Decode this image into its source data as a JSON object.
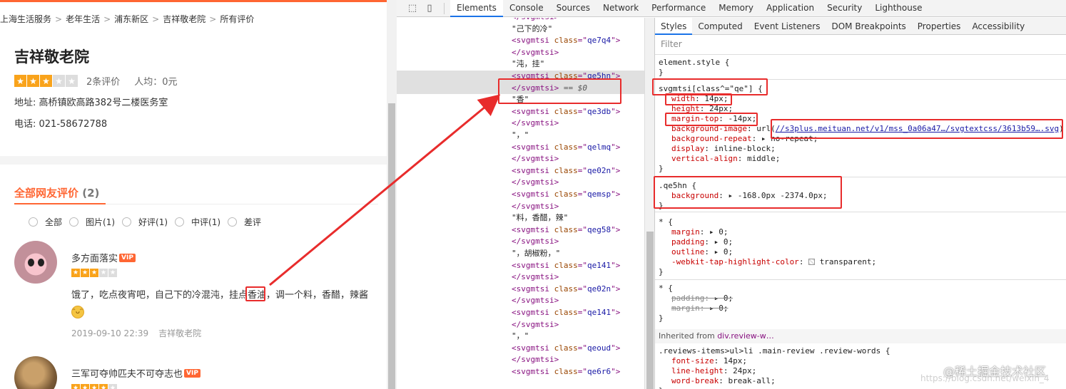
{
  "page": {
    "breadcrumb": [
      "上海生活服务",
      "老年生活",
      "浦东新区",
      "吉祥敬老院",
      "所有评价"
    ],
    "breadcrumb_sep": ">",
    "shop_name": "吉祥敬老院",
    "star_rating": 3,
    "star_max": 5,
    "review_count": "2条评价",
    "avg_price": "人均：0元",
    "address": "地址: 高桥镇欧高路382号二楼医务室",
    "phone": "电话: 021-58672788",
    "reviews_heading": "全部网友评价",
    "reviews_heading_count": "(2)",
    "filters": [
      "全部",
      "图片(1)",
      "好评(1)",
      "中评(1)",
      "差评"
    ],
    "vip_label": "VIP",
    "reviews": [
      {
        "user": "多方面落实",
        "stars": 3,
        "text": "饿了，吃点夜宵吧，自己下的冷混沌，挂点香油，调一个料，香醋，辣酱",
        "date": "2019-09-10 22:39",
        "shop": "吉祥敬老院"
      },
      {
        "user": "三军可夺帅匹夫不可夺志也",
        "stars": 4
      }
    ]
  },
  "devtools": {
    "panels": [
      "Elements",
      "Console",
      "Sources",
      "Network",
      "Performance",
      "Memory",
      "Application",
      "Security",
      "Lighthouse"
    ],
    "active_panel": "Elements",
    "elements_lines": [
      {
        "type": "close",
        "tag": "svgmtsi"
      },
      {
        "type": "text",
        "text": "\"己下的冷\""
      },
      {
        "type": "open",
        "tag": "svgmtsi",
        "attr": "class",
        "val": "qe7q4"
      },
      {
        "type": "close",
        "tag": "svgmtsi"
      },
      {
        "type": "text",
        "text": "\"沌，挂\""
      },
      {
        "type": "open",
        "tag": "svgmtsi",
        "attr": "class",
        "val": "qe5hn",
        "selected": true
      },
      {
        "type": "close",
        "tag": "svgmtsi",
        "selected": true,
        "suffix": " == $0"
      },
      {
        "type": "text",
        "text": "\"香\""
      },
      {
        "type": "open",
        "tag": "svgmtsi",
        "attr": "class",
        "val": "qe3db"
      },
      {
        "type": "close",
        "tag": "svgmtsi"
      },
      {
        "type": "text",
        "text": "\"，\""
      },
      {
        "type": "open",
        "tag": "svgmtsi",
        "attr": "class",
        "val": "qelmq"
      },
      {
        "type": "close",
        "tag": "svgmtsi"
      },
      {
        "type": "open",
        "tag": "svgmtsi",
        "attr": "class",
        "val": "qe02n"
      },
      {
        "type": "close",
        "tag": "svgmtsi"
      },
      {
        "type": "open",
        "tag": "svgmtsi",
        "attr": "class",
        "val": "qemsp"
      },
      {
        "type": "close",
        "tag": "svgmtsi"
      },
      {
        "type": "text",
        "text": "\"料，香醋，辣\""
      },
      {
        "type": "open",
        "tag": "svgmtsi",
        "attr": "class",
        "val": "qeg58"
      },
      {
        "type": "close",
        "tag": "svgmtsi"
      },
      {
        "type": "text",
        "text": "\"，胡椒粉，\""
      },
      {
        "type": "open",
        "tag": "svgmtsi",
        "attr": "class",
        "val": "qe141"
      },
      {
        "type": "close",
        "tag": "svgmtsi"
      },
      {
        "type": "open",
        "tag": "svgmtsi",
        "attr": "class",
        "val": "qe02n"
      },
      {
        "type": "close",
        "tag": "svgmtsi"
      },
      {
        "type": "open",
        "tag": "svgmtsi",
        "attr": "class",
        "val": "qe141"
      },
      {
        "type": "close",
        "tag": "svgmtsi"
      },
      {
        "type": "text",
        "text": "\"，\""
      },
      {
        "type": "open",
        "tag": "svgmtsi",
        "attr": "class",
        "val": "qeoud"
      },
      {
        "type": "close",
        "tag": "svgmtsi"
      },
      {
        "type": "open",
        "tag": "svgmtsi",
        "attr": "class",
        "val": "qe6r6"
      }
    ],
    "styles_tabs": [
      "Styles",
      "Computed",
      "Event Listeners",
      "DOM Breakpoints",
      "Properties",
      "Accessibility"
    ],
    "active_styles_tab": "Styles",
    "filter_placeholder": "Filter",
    "element_style": "element.style {",
    "rule1": {
      "selector": "svgmtsi[class^=\"qe\"] {",
      "props": [
        {
          "name": "width",
          "value": "14px;"
        },
        {
          "name": "height",
          "value": "24px;"
        },
        {
          "name": "margin-top",
          "value": "-14px;"
        },
        {
          "name": "background-image",
          "value": "url(",
          "url": "//s3plus.meituan.net/v1/mss_0a06a47…/svgtextcss/3613b59….svg",
          "tail": ")"
        },
        {
          "name": "background-repeat",
          "value": "▸ no-repeat;"
        },
        {
          "name": "display",
          "value": "inline-block;"
        },
        {
          "name": "vertical-align",
          "value": "middle;"
        }
      ]
    },
    "rule2": {
      "selector": ".qe5hn {",
      "props": [
        {
          "name": "background",
          "value": "▸ -168.0px -2374.0px;"
        }
      ]
    },
    "rule3": {
      "selector": "* {",
      "props": [
        {
          "name": "margin",
          "value": "▸ 0;"
        },
        {
          "name": "padding",
          "value": "▸ 0;"
        },
        {
          "name": "outline",
          "value": "▸ 0;"
        },
        {
          "name": "-webkit-tap-highlight-color",
          "value": "transparent;"
        }
      ]
    },
    "rule4": {
      "selector": "* {",
      "props": [
        {
          "name": "padding",
          "value": "▸ 0;"
        },
        {
          "name": "margin",
          "value": "▸ 0;"
        }
      ]
    },
    "inherited_label": "Inherited from",
    "inherited_from": "div.review-w…",
    "rule5": {
      "selector": ".reviews-items>ul>li .main-review .review-words {",
      "props": [
        {
          "name": "font-size",
          "value": "14px;"
        },
        {
          "name": "line-height",
          "value": "24px;"
        },
        {
          "name": "word-break",
          "value": "break-all;"
        }
      ]
    }
  },
  "watermark": "@稀土掘金技术社区",
  "watermark_url": "https://blog.csdn.net/weixin_4",
  "colors": {
    "accent": "#ff6633",
    "annotation": "#e82c2c",
    "star": "#f9a31b"
  },
  "icons": [
    "inspect-icon",
    "device-toggle-icon",
    "more-dots-icon",
    "emoji-grin-icon"
  ]
}
